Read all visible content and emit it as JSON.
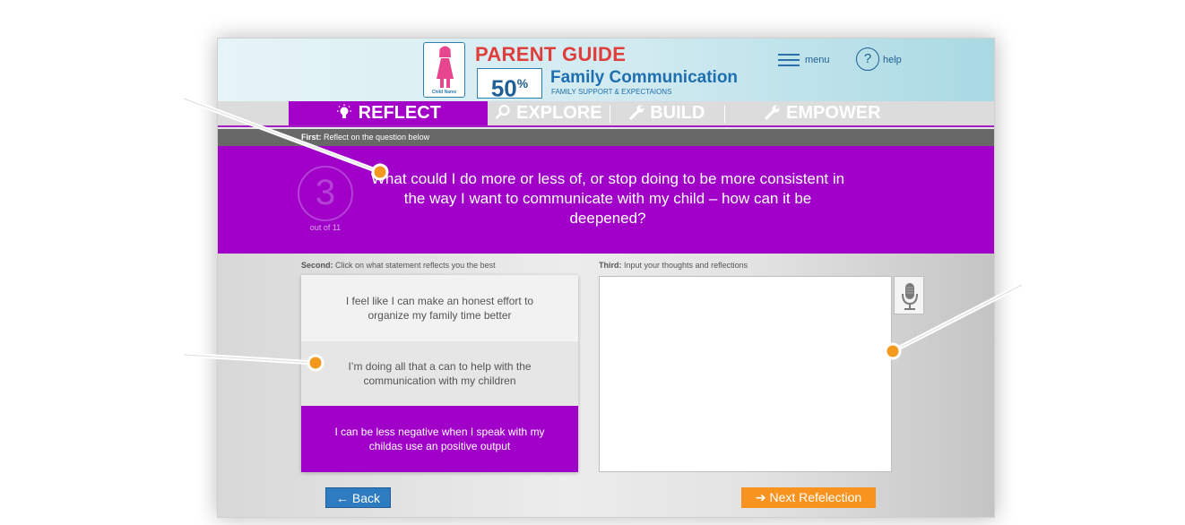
{
  "header": {
    "avatar_label": "Child Name",
    "guide_title": "PARENT GUIDE",
    "progress_percent": "50",
    "progress_symbol": "%",
    "topic_title": "Family Communication",
    "topic_subtitle": "FAMILY SUPPORT & EXPECTAIONS",
    "menu_label": "menu",
    "help_glyph": "?",
    "help_label": "help"
  },
  "tabs": [
    {
      "label": "REFLECT",
      "icon": "lightbulb-icon",
      "active": true
    },
    {
      "label": "EXPLORE",
      "icon": "magnifier-icon",
      "active": false
    },
    {
      "label": "BUILD",
      "icon": "wrench-icon",
      "active": false
    },
    {
      "label": "EMPOWER",
      "icon": "wrench-icon",
      "active": false
    }
  ],
  "instructions": {
    "first_bold": "First:",
    "first_text": " Reflect on the question below",
    "second_bold": "Second:",
    "second_text": " Click on what statement reflects you the best",
    "third_bold": "Third:",
    "third_text": " Input your thoughts and reflections"
  },
  "question": {
    "number": "3",
    "count_label": "out of 11",
    "text": "What could I do more or less of, or stop doing to be more consistent in the way I want to communicate with my child – how can it be deepened?"
  },
  "statements": [
    {
      "text": "I feel like I can make an honest effort to organize my family time better",
      "selected": false
    },
    {
      "text": "I’m doing all that a can to help with the communication with my children",
      "selected": false
    },
    {
      "text": "I can be less negative when I speak with my childas use an positive output",
      "selected": true
    }
  ],
  "reflection": {
    "value": "",
    "placeholder": ""
  },
  "nav": {
    "back_label": "Back",
    "next_label": "Next Refelection"
  },
  "colors": {
    "brand_purple": "#a000c8",
    "back_blue": "#2d7cc1",
    "next_orange": "#f7931e",
    "title_red": "#e03d3d",
    "callout_orange": "#f39a1e"
  }
}
